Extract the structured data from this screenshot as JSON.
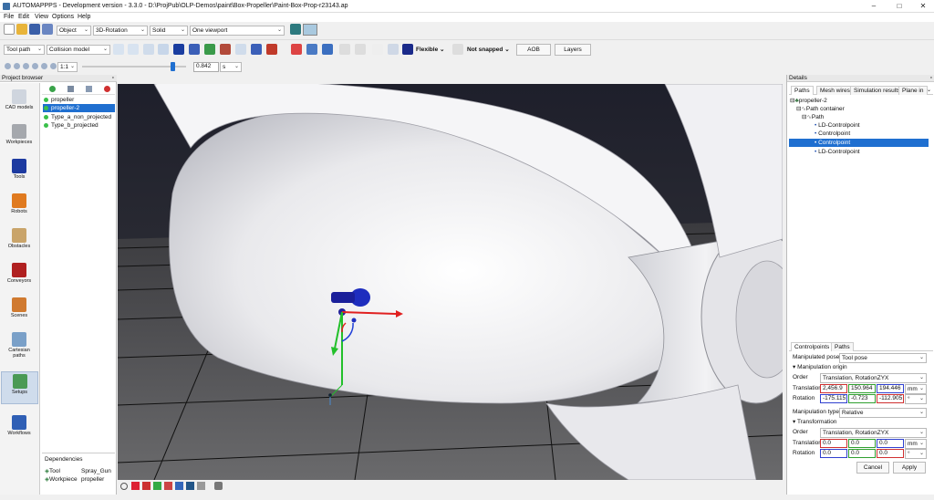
{
  "window": {
    "title": "AUTOMAPPPS - Development version - 3.3.0 - D:\\ProjPub\\OLP-Demos\\paint\\Box-Propeller\\Paint-Box-Prop-r23143.ap",
    "minimize": "–",
    "maximize": "□",
    "close": "✕"
  },
  "menu": [
    "File",
    "Edit",
    "View",
    "Options",
    "Help"
  ],
  "toolbar1": {
    "object_combo": "Object",
    "rotation_combo": "3D-Rotation",
    "solid_combo": "Solid",
    "viewport_combo": "One viewport"
  },
  "toolbar2": {
    "toolpath_combo": "Tool path",
    "collision_combo": "Collision model",
    "flexible_label": "Flexible",
    "snapped_label": "Not snapped",
    "aob_label": "AOB",
    "layers_label": "Layers"
  },
  "toolbar3": {
    "ratio_combo": "1:1",
    "slider_value": 0.842,
    "time_value": "0.842",
    "unit_combo": "s"
  },
  "project_browser": {
    "title": "Project browser",
    "library": [
      "CAD models",
      "Workpieces",
      "Tools",
      "Robots",
      "Obstacles",
      "Conveyors",
      "Scenes",
      "Cartesian paths",
      "Setups",
      "Workflows"
    ],
    "selected_library": "Setups",
    "items": [
      "propeller",
      "propeller-2",
      "Type_a_non_projected",
      "Type_b_projected"
    ],
    "selected_item": "propeller-2",
    "dependencies": {
      "title": "Dependencies",
      "rows": [
        {
          "key": "Tool",
          "value": "Spray_Gun"
        },
        {
          "key": "Workpiece",
          "value": "propeller"
        }
      ]
    }
  },
  "details": {
    "title": "Details",
    "tabs": [
      "Paths",
      "Mesh wires",
      "Simulation results",
      "Plane in"
    ],
    "tree": [
      {
        "label": "propeller-2",
        "level": 0
      },
      {
        "label": "Path container",
        "level": 1
      },
      {
        "label": "Path",
        "level": 2
      },
      {
        "label": "LD-Controlpoint",
        "level": 3
      },
      {
        "label": "Controlpoint",
        "level": 3
      },
      {
        "label": "Controlpoint",
        "level": 3
      },
      {
        "label": "LD-Controlpoint",
        "level": 3
      }
    ],
    "selected_tree_index": 5,
    "bottom_tabs": [
      "Controlpoints",
      "Paths"
    ],
    "manipulated_pose_label": "Manipulated pose",
    "manipulated_pose": "Tool pose",
    "origin_header": "Manipulation origin",
    "order_label": "Order",
    "order_value": "Translation, RotationZYX",
    "translation_label": "Translation",
    "translation": [
      "2,456.9",
      "150.964",
      "194.446"
    ],
    "translation_unit": "mm",
    "rotation_label": "Rotation",
    "rotation": [
      "-175.115",
      "-0.723",
      "-112.905"
    ],
    "rotation_unit": "°",
    "manipulation_type_label": "Manipulation type",
    "manipulation_type": "Relative",
    "transformation_header": "Transformation",
    "t_order_value": "Translation, RotationZYX",
    "t_translation": [
      "0.0",
      "0.0",
      "0.0"
    ],
    "t_rotation": [
      "0.0",
      "0.0",
      "0.0"
    ],
    "cancel_label": "Cancel",
    "apply_label": "Apply"
  }
}
